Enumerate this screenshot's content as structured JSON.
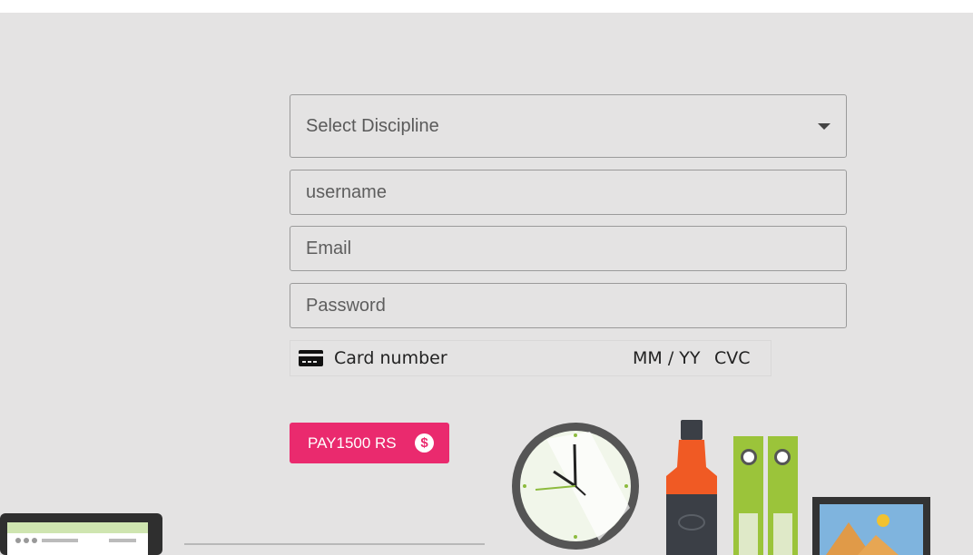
{
  "form": {
    "discipline_select": {
      "placeholder": "Select Discipline"
    },
    "username": {
      "placeholder": "username",
      "value": ""
    },
    "email": {
      "placeholder": "Email",
      "value": ""
    },
    "password": {
      "placeholder": "Password",
      "value": ""
    },
    "card": {
      "number_placeholder": "Card number",
      "expiry_placeholder": "MM / YY",
      "cvc_placeholder": "CVC"
    },
    "pay_button": {
      "label": "PAY1500 RS",
      "icon": "dollar-circle-icon"
    }
  },
  "colors": {
    "background": "#e4e3e3",
    "accent": "#ea2a6e",
    "border": "#9a9a9a"
  }
}
